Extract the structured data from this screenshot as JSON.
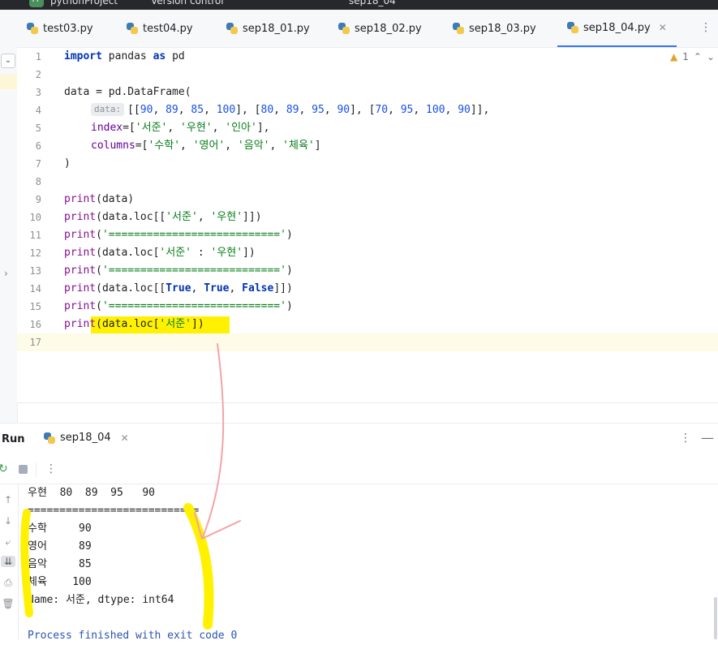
{
  "titlebar": {
    "project_badge": "PP",
    "project_name": "pythonProject",
    "vcs": "Version control",
    "run_config": "sep18_04"
  },
  "tabs": [
    {
      "label": "test03.py",
      "active": false
    },
    {
      "label": "test04.py",
      "active": false
    },
    {
      "label": "sep18_01.py",
      "active": false
    },
    {
      "label": "sep18_02.py",
      "active": false
    },
    {
      "label": "sep18_03.py",
      "active": false
    },
    {
      "label": "sep18_04.py",
      "active": true
    }
  ],
  "editor": {
    "warning_count": "1",
    "line_numbers": [
      "1",
      "2",
      "3",
      "4",
      "5",
      "6",
      "7",
      "8",
      "9",
      "10",
      "11",
      "12",
      "13",
      "14",
      "15",
      "16",
      "17"
    ],
    "inlay_hint": "data:",
    "code": {
      "l1_kw1": "import",
      "l1_mod": " pandas ",
      "l1_kw2": "as",
      "l1_alias": " pd",
      "l3": "data = pd.DataFrame(",
      "l4_open": "[[",
      "l4_a": "90",
      "l4_b": "89",
      "l4_c": "85",
      "l4_d": "100",
      "l4_e": "80",
      "l4_f": "89",
      "l4_g": "95",
      "l4_h": "90",
      "l4_i": "70",
      "l4_j": "95",
      "l4_k": "100",
      "l4_l": "90",
      "l5_param": "index",
      "l5_s1": "'서준'",
      "l5_s2": "'우현'",
      "l5_s3": "'인아'",
      "l6_param": "columns",
      "l6_s1": "'수학'",
      "l6_s2": "'영어'",
      "l6_s3": "'음악'",
      "l6_s4": "'체육'",
      "l7": ")",
      "print": "print",
      "l9_rest": "(data)",
      "l10_pre": "(data.loc[[",
      "l10_s1": "'서준'",
      "l10_s2": "'우현'",
      "l10_post": "]])",
      "sep_str": "'==========================='",
      "l12_pre": "(data.loc[",
      "l12_s1": "'서준'",
      "l12_mid": " : ",
      "l12_s2": "'우현'",
      "l12_post": "])",
      "l14_pre": "(data.loc[[",
      "kw_true": "True",
      "kw_false": "False",
      "l14_post": "]])",
      "l16_pre": "(data.loc[",
      "l16_s1": "'서준'",
      "l16_post": "])"
    }
  },
  "run": {
    "title": "Run",
    "tab_label": "sep18_04",
    "output": [
      "우현  80  89  95   90",
      "===========================",
      "수학     90",
      "영어     89",
      "음악     85",
      "체육    100",
      "Name: 서준, dtype: int64",
      "",
      "Process finished with exit code 0"
    ]
  },
  "colors": {
    "highlight_yellow": "#fff100",
    "arrow_pink": "#f4a3a8",
    "accent_blue": "#3574f0"
  }
}
